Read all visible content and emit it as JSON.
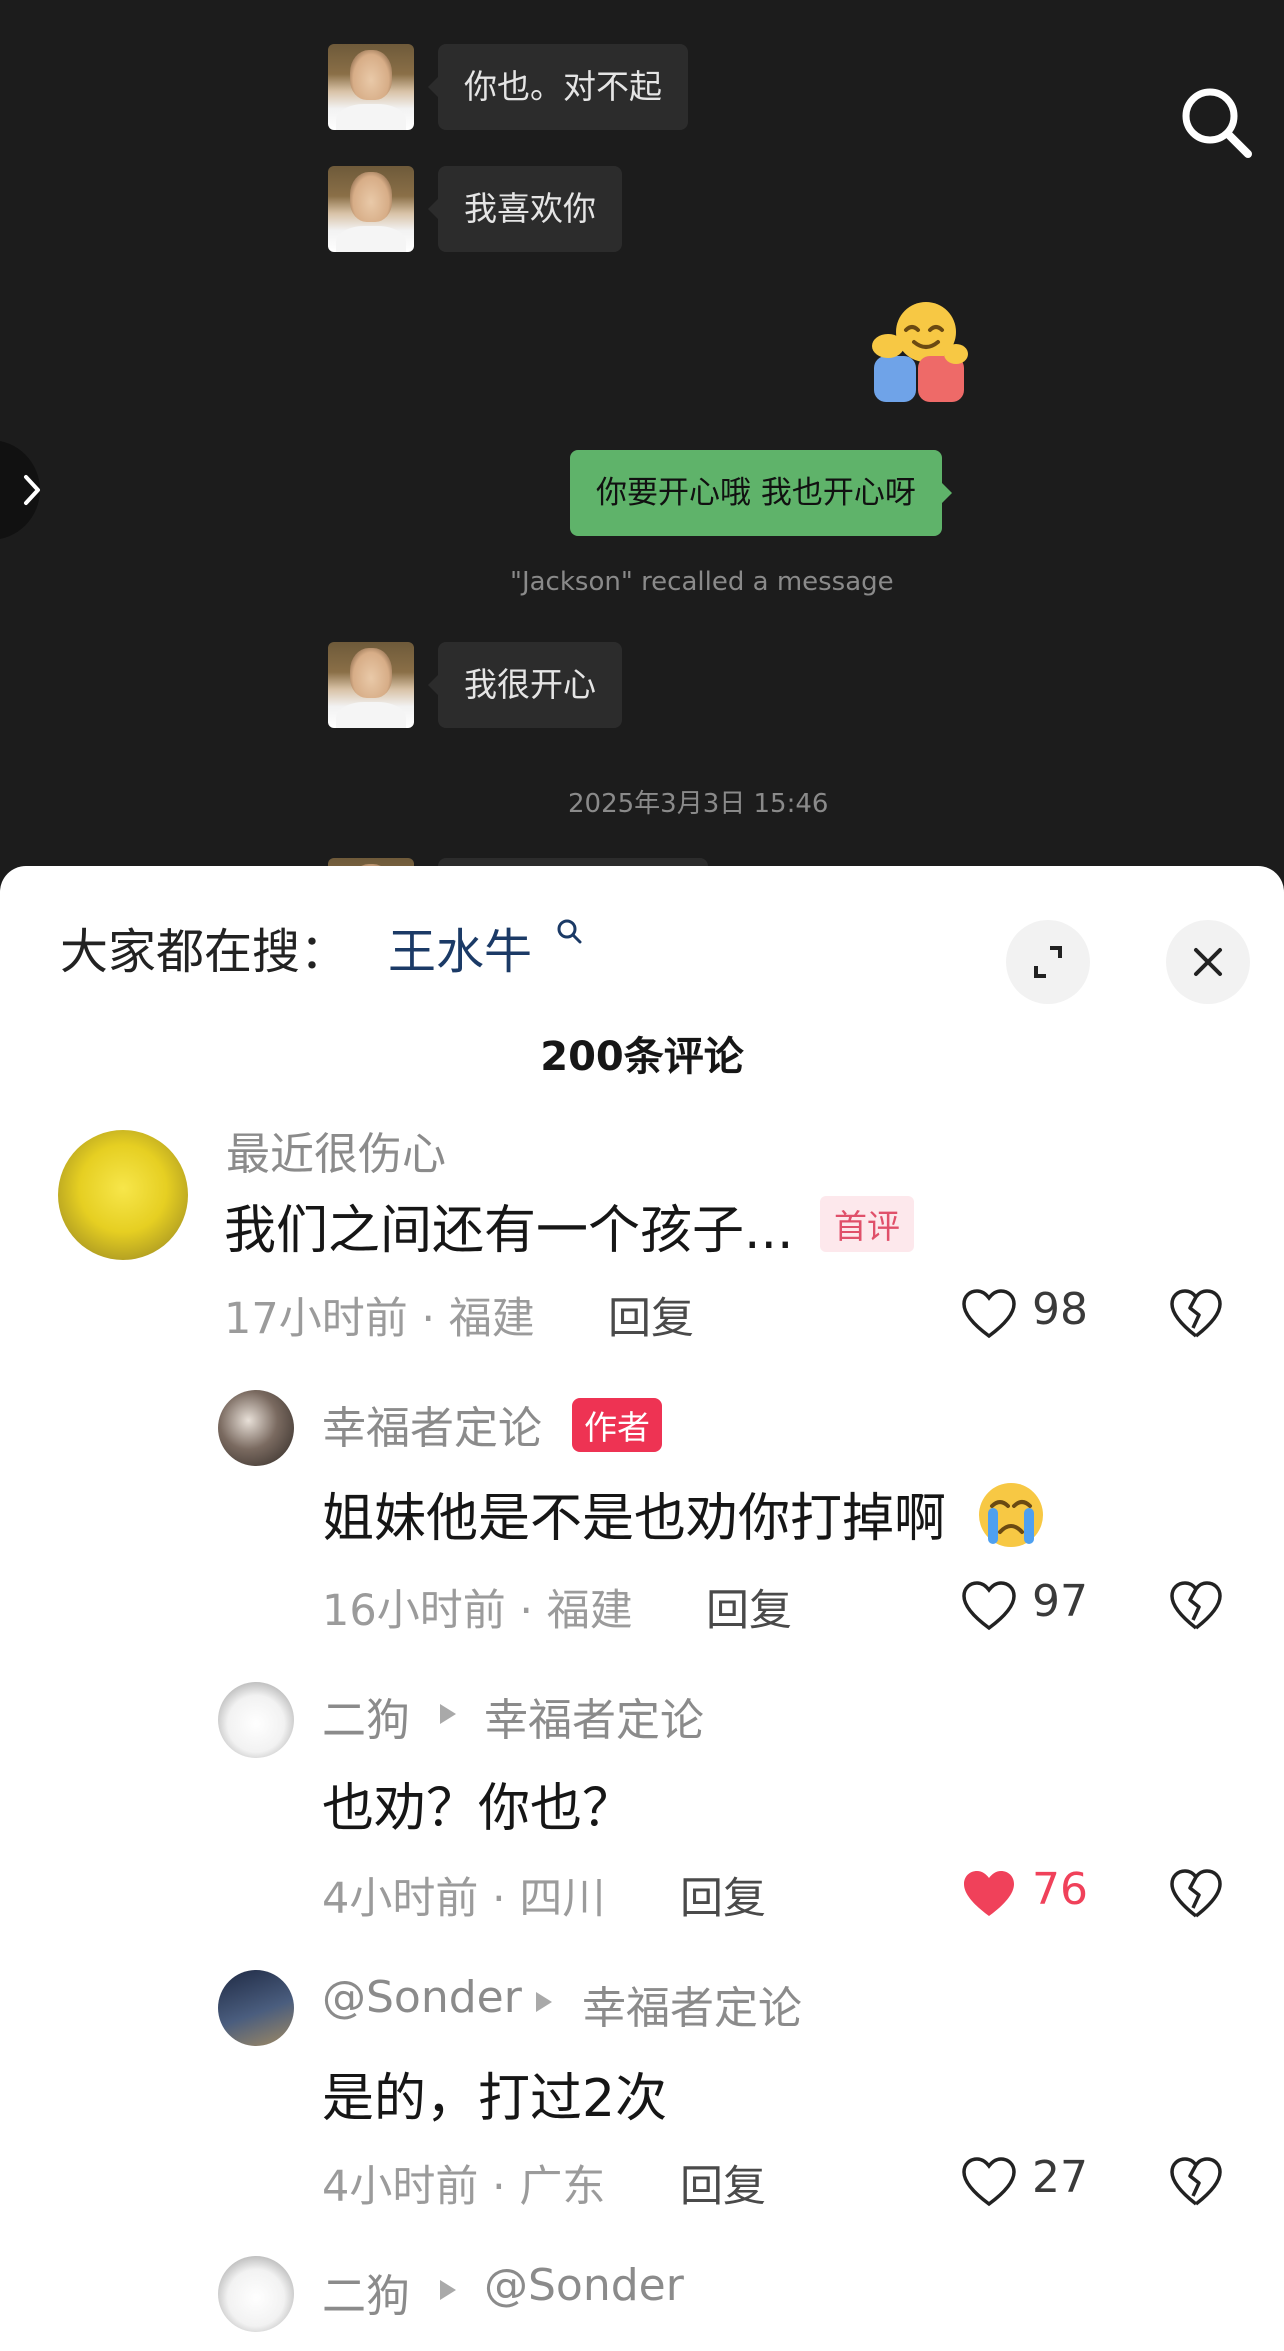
{
  "chat": {
    "messages_in": [
      "你也。对不起",
      "我喜欢你",
      "我很开心"
    ],
    "message_out": "你要开心哦 我也开心呀",
    "recall_notice": "\"Jackson\" recalled a message",
    "timestamp": "2025年3月3日 15:46"
  },
  "icons": {
    "search": "search-icon",
    "side_expand": "chevron-right-icon",
    "expand": "expand-icon",
    "close": "close-icon",
    "like": "heart-icon",
    "dislike": "broken-heart-icon",
    "sticker": "hug-emoji"
  },
  "sheet": {
    "hot_search_prefix": "大家都在搜：",
    "hot_search_keyword": "王水牛",
    "comment_count": "200条评论"
  },
  "comments": [
    {
      "name": "最近很伤心",
      "text": "我们之间还有一个孩子...",
      "tag": "首评",
      "meta": "17小时前 · 福建",
      "reply": "回复",
      "likes": "98",
      "liked": false
    },
    {
      "name": "幸福者定论",
      "tag": "作者",
      "text": "姐妹他是不是也劝你打掉啊",
      "meta": "16小时前 · 福建",
      "reply": "回复",
      "likes": "97",
      "liked": false
    },
    {
      "name": "二狗",
      "reply_to": "幸福者定论",
      "text": "也劝？你也？",
      "meta": "4小时前 · 四川",
      "reply": "回复",
      "likes": "76",
      "liked": true
    },
    {
      "name": "@Sonder",
      "reply_to": "幸福者定论",
      "text": "是的，打过2次",
      "meta": "4小时前 · 广东",
      "reply": "回复",
      "likes": "27",
      "liked": false
    },
    {
      "name": "二狗",
      "reply_to": "@Sonder"
    }
  ],
  "colors": {
    "chat_bg": "#1c1c1c",
    "out_bubble": "#5fb36a",
    "like_red": "#f0415a",
    "author_tag": "#ee3353",
    "keyword_blue": "#1b3a66"
  }
}
